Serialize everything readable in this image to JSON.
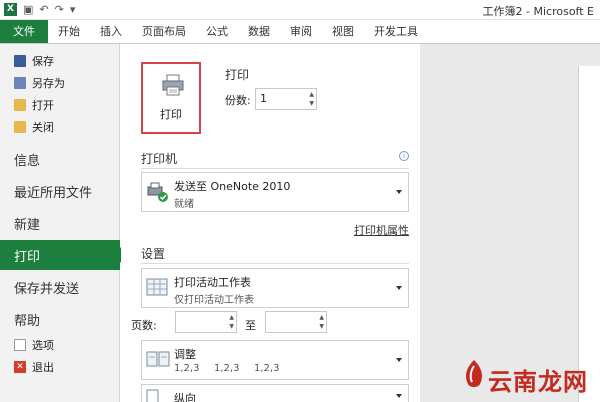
{
  "window": {
    "title": "工作簿2 - Microsoft E"
  },
  "ribbon": {
    "file_tab": "文件",
    "tabs": [
      "开始",
      "插入",
      "页面布局",
      "公式",
      "数据",
      "审阅",
      "视图",
      "开发工具"
    ]
  },
  "nav": {
    "small_items": [
      {
        "label": "保存",
        "icon": "save-icon"
      },
      {
        "label": "另存为",
        "icon": "save-as-icon"
      },
      {
        "label": "打开",
        "icon": "open-folder-icon"
      },
      {
        "label": "关闭",
        "icon": "close-folder-icon"
      }
    ],
    "info": "信息",
    "recent": "最近所用文件",
    "new": "新建",
    "print": "打印",
    "save_send": "保存并发送",
    "help": "帮助",
    "options": "选项",
    "exit": "退出"
  },
  "print_panel": {
    "print_button": "打印",
    "print_section": "打印",
    "copies_label": "份数:",
    "copies_value": "1",
    "printer_section": "打印机",
    "printer_name": "发送至 OneNote 2010",
    "printer_status": "就绪",
    "printer_properties": "打印机属性",
    "settings_section": "设置",
    "scope_title": "打印活动工作表",
    "scope_desc": "仅打印活动工作表",
    "pages_label": "页数:",
    "to_label": "至",
    "collate_title": "调整",
    "collate_desc": [
      "1,2,3",
      "1,2,3",
      "1,2,3"
    ],
    "orientation_title": "纵向"
  },
  "watermark": {
    "text": "云南龙网"
  },
  "colors": {
    "accent": "#1d7f3e",
    "highlight_border": "#d9434a"
  }
}
